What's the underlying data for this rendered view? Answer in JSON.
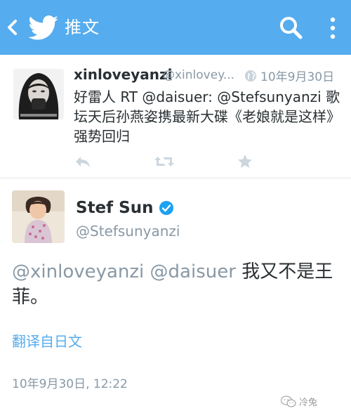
{
  "appbar": {
    "title": "推文",
    "icons": [
      "back-chevron-icon",
      "twitter-bird-icon",
      "search-icon",
      "more-vert-icon"
    ],
    "color": "#55acee"
  },
  "quoted_tweet": {
    "name": "xinloveyanzi",
    "handle": "@xinlovey...",
    "time": "10年9月30日",
    "text": "好雷人 RT @daisuer: @Stefsunyanzi 歌坛天后孙燕姿携最新大碟《老娘就是这样》强势回归",
    "actions": [
      "reply-icon",
      "retweet-icon",
      "favorite-star-icon"
    ]
  },
  "main_tweet": {
    "name": "Stef Sun",
    "handle": "@Stefsunyanzi",
    "mention1": "@xinloveyanzi",
    "mention2": "@daisuer",
    "text_tail": "我又不是王菲。",
    "translate": "翻译自日文",
    "timestamp": "10年9月30日, 12:22"
  },
  "watermark": {
    "text": "冷兔"
  },
  "colors": {
    "accent": "#55acee",
    "text": "#292f33",
    "muted": "#8899a6",
    "verified": "#1da1f2"
  }
}
